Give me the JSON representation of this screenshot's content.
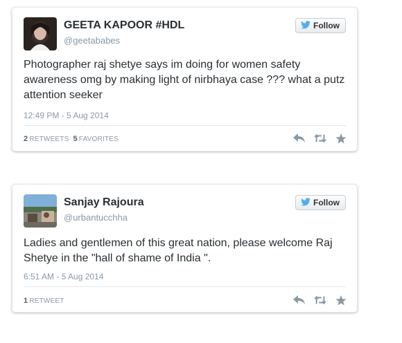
{
  "tweets": [
    {
      "name": "GEETA KAPOOR #HDL",
      "handle": "@geetababes",
      "follow_label": "Follow",
      "text": "Photographer raj shetye says im doing for women safety awareness omg by making light of nirbhaya case ??? what a putz attention seeker",
      "timestamp": "12:49 PM - 5 Aug 2014",
      "retweets_count": "2",
      "retweets_label": "RETWEETS",
      "favorites_count": "5",
      "favorites_label": "FAVORITES",
      "avatar_icon": "woman-portrait-avatar"
    },
    {
      "name": "Sanjay Rajoura",
      "handle": "@urbantucchha",
      "follow_label": "Follow",
      "text": "Ladies and gentlemen of this great nation, please welcome Raj Shetye in the \"hall of shame of India \".",
      "timestamp": "6:51 AM - 5 Aug 2014",
      "retweets_count": "1",
      "retweets_label": "RETWEET",
      "avatar_icon": "outdoor-photo-avatar"
    }
  ],
  "colors": {
    "twitter_blue": "#55acee",
    "icon_gray": "#8899a6",
    "text_dark": "#292f33"
  },
  "icons": [
    "twitter-bird-icon",
    "reply-icon",
    "retweet-icon",
    "favorite-star-icon"
  ]
}
